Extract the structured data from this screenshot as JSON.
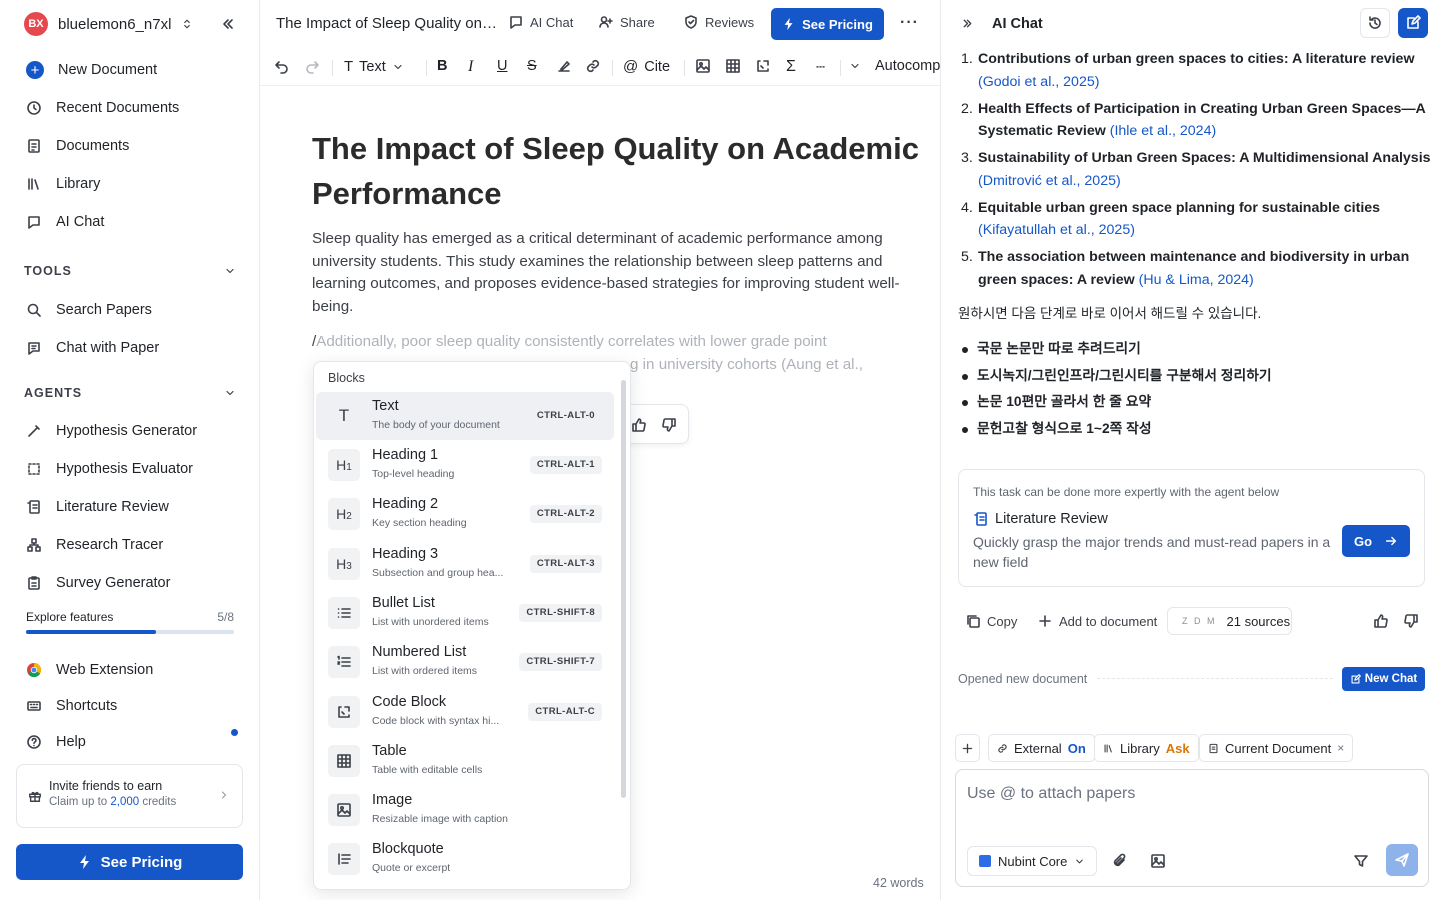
{
  "sidebar": {
    "avatar_initials": "BX",
    "workspace_name": "bluelemon6_n7xl",
    "nav": [
      {
        "label": "New Document"
      },
      {
        "label": "Recent Documents"
      },
      {
        "label": "Documents"
      },
      {
        "label": "Library"
      },
      {
        "label": "AI Chat"
      }
    ],
    "tools_header": "TOOLS",
    "tools": [
      {
        "label": "Search Papers"
      },
      {
        "label": "Chat with Paper"
      }
    ],
    "agents_header": "AGENTS",
    "agents": [
      {
        "label": "Hypothesis Generator"
      },
      {
        "label": "Hypothesis Evaluator"
      },
      {
        "label": "Literature Review"
      },
      {
        "label": "Research Tracer"
      },
      {
        "label": "Survey Generator"
      }
    ],
    "explore_label": "Explore features",
    "explore_count": "5/8",
    "explore_progress": 0.625,
    "bottom": [
      {
        "label": "Web Extension"
      },
      {
        "label": "Shortcuts"
      },
      {
        "label": "Help"
      }
    ],
    "invite_title": "Invite friends to earn",
    "invite_sub_prefix": "Claim up to ",
    "invite_credits": "2,000",
    "invite_sub_suffix": " credits",
    "pricing_label": "See Pricing"
  },
  "editor": {
    "doc_title": "The Impact of Sleep Quality on Academic Performance",
    "header_buttons": {
      "ai_chat": "AI Chat",
      "share": "Share",
      "reviews": "Reviews",
      "pricing": "See Pricing"
    },
    "toolbar": {
      "text_style": "Text",
      "cite": "Cite",
      "autocomplete": "Autocomp"
    },
    "heading": "The Impact of Sleep Quality on Academic Performance",
    "paragraph": "Sleep quality has emerged as a critical determinant of academic performance among university students. This study examines the relationship between sleep patterns and learning outcomes, and proposes evidence-based strategies for improving student well-being.",
    "ghost_slash": "/",
    "ghost_line1": "Additionally, poor sleep quality consistently correlates with lower grade point",
    "ghost_line2_tail": "g in university cohorts (Aung et al.,",
    "word_count": "42 words"
  },
  "block_menu": {
    "header": "Blocks",
    "items": [
      {
        "icon": "T",
        "name": "Text",
        "desc": "The body of your document",
        "shortcut": "CTRL-ALT-0"
      },
      {
        "icon": "H1",
        "name": "Heading 1",
        "desc": "Top-level heading",
        "shortcut": "CTRL-ALT-1"
      },
      {
        "icon": "H2",
        "name": "Heading 2",
        "desc": "Key section heading",
        "shortcut": "CTRL-ALT-2"
      },
      {
        "icon": "H3",
        "name": "Heading 3",
        "desc": "Subsection and group hea...",
        "shortcut": "CTRL-ALT-3"
      },
      {
        "icon": "bullet-list",
        "name": "Bullet List",
        "desc": "List with unordered items",
        "shortcut": "CTRL-SHIFT-8"
      },
      {
        "icon": "numbered-list",
        "name": "Numbered List",
        "desc": "List with ordered items",
        "shortcut": "CTRL-SHIFT-7"
      },
      {
        "icon": "code",
        "name": "Code Block",
        "desc": "Code block with syntax hi...",
        "shortcut": "CTRL-ALT-C"
      },
      {
        "icon": "table",
        "name": "Table",
        "desc": "Table with editable cells",
        "shortcut": ""
      },
      {
        "icon": "image",
        "name": "Image",
        "desc": "Resizable image with caption",
        "shortcut": ""
      },
      {
        "icon": "quote",
        "name": "Blockquote",
        "desc": "Quote or excerpt",
        "shortcut": ""
      }
    ]
  },
  "chat": {
    "title": "AI Chat",
    "references": [
      {
        "num": "1.",
        "title": "Contributions of urban green spaces to cities: A literature review",
        "cite": "(Godoi et al., 2025)"
      },
      {
        "num": "2.",
        "title": "Health Effects of Participation in Creating Urban Green Spaces—A Systematic Review",
        "cite": "(Ihle et al., 2024)"
      },
      {
        "num": "3.",
        "title": "Sustainability of Urban Green Spaces: A Multidimensional Analysis",
        "cite": "(Dmitrović et al., 2025)"
      },
      {
        "num": "4.",
        "title": "Equitable urban green space planning for sustainable cities",
        "cite": "(Kifayatullah et al., 2025)"
      },
      {
        "num": "5.",
        "title": "The association between maintenance and biodiversity in urban green spaces: A review",
        "cite": "(Hu & Lima, 2024)"
      }
    ],
    "korean_intro": "원하시면 다음 단계로 바로 이어서 해드릴 수 있습니다.",
    "korean_bullets": [
      "국문 논문만 따로 추려드리기",
      "도시녹지/그린인프라/그린시티를 구분해서 정리하기",
      "논문 10편만 골라서 한 줄 요약",
      "문헌고찰 형식으로 1~2쪽 작성"
    ],
    "agent_hint": "This task can be done more expertly with the agent below",
    "agent_name": "Literature Review",
    "agent_desc": "Quickly grasp the major trends and must-read papers in a new field",
    "go_label": "Go",
    "copy_label": "Copy",
    "add_label": "Add to document",
    "sources_favicons": "Z D M",
    "sources_label": "21 sources",
    "opened_label": "Opened new document",
    "new_chat_label": "New Chat",
    "chips": {
      "external": "External",
      "external_state": "On",
      "library": "Library",
      "library_state": "Ask",
      "current": "Current Document",
      "current_close": "×"
    },
    "input_placeholder": "Use @ to attach papers",
    "model_name": "Nubint Core",
    "colors": {
      "accent": "#1557c8",
      "ask": "#d97706",
      "avatar": "#e5484d"
    }
  }
}
